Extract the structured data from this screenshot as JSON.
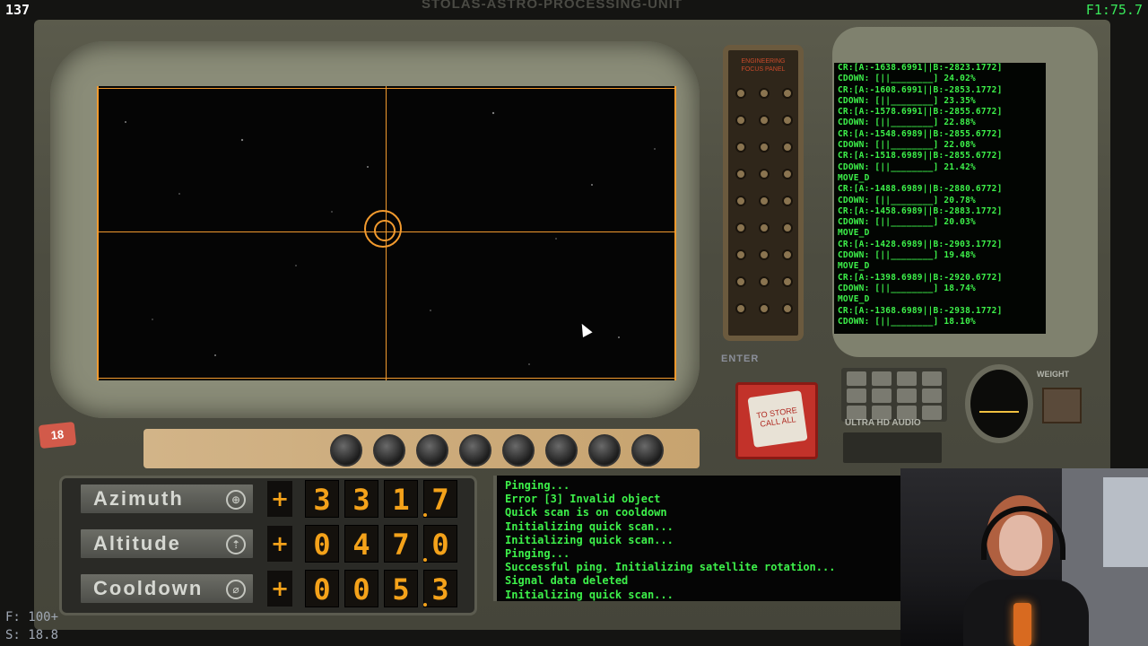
{
  "hud": {
    "counter": "137",
    "fps": "F1:75.7",
    "window_title": "STOLAS-ASTRO-PROCESSING-UNIT",
    "frame_stat": "F: 100+",
    "speed_stat": "S: 18.8"
  },
  "panel_labels": {
    "patch_panel": "ENGINEERING FOCUS PANEL",
    "button_18": "18",
    "enter_label": "ENTER",
    "red_button_text": "TO STORE CALL ALL",
    "audio": "ULTRA HD AUDIO",
    "weight": "WEIGHT"
  },
  "readouts": [
    {
      "label": "Azimuth",
      "icon": "compass-icon",
      "sign": "+",
      "digits": [
        "3",
        "3",
        "1",
        "7"
      ]
    },
    {
      "label": "Altitude",
      "icon": "altitude-icon",
      "sign": "+",
      "digits": [
        "0",
        "4",
        "7",
        "0"
      ]
    },
    {
      "label": "Cooldown",
      "icon": "thermometer-icon",
      "sign": "+",
      "digits": [
        "0",
        "0",
        "5",
        "3"
      ]
    }
  ],
  "terminal": [
    "Pinging...",
    "Error [3] Invalid object",
    "Quick scan is on cooldown",
    "Initializing quick scan...",
    "Initializing quick scan...",
    "Pinging...",
    "Successful ping. Initializing satellite rotation...",
    "Signal data deleted",
    "Initializing quick scan..."
  ],
  "log_monitor": [
    "CR:[A:-1638.6991||B:-2823.1772]",
    "CDOWN: [||________] 24.02%",
    "CR:[A:-1608.6991||B:-2853.1772]",
    "CDOWN: [||________] 23.35%",
    "CR:[A:-1578.6991||B:-2855.6772]",
    "CDOWN: [||________] 22.88%",
    "CR:[A:-1548.6989||B:-2855.6772]",
    "CDOWN: [||________] 22.08%",
    "CR:[A:-1518.6989||B:-2855.6772]",
    "CDOWN: [||________] 21.42%",
    "MOVE_D",
    "CR:[A:-1488.6989||B:-2880.6772]",
    "CDOWN: [||________] 20.78%",
    "CR:[A:-1458.6989||B:-2883.1772]",
    "CDOWN: [||________] 20.03%",
    "MOVE_D",
    "CR:[A:-1428.6989||B:-2903.1772]",
    "CDOWN: [||________] 19.48%",
    "MOVE_D",
    "CR:[A:-1398.6989||B:-2920.6772]",
    "CDOWN: [||________] 18.74%",
    "MOVE_D",
    "CR:[A:-1368.6989||B:-2938.1772]",
    "CDOWN: [||________] 18.10%"
  ],
  "colors": {
    "screen_accent": "#f29a2e",
    "terminal_green": "#3df04a",
    "readout_amber": "#f4a21a"
  }
}
